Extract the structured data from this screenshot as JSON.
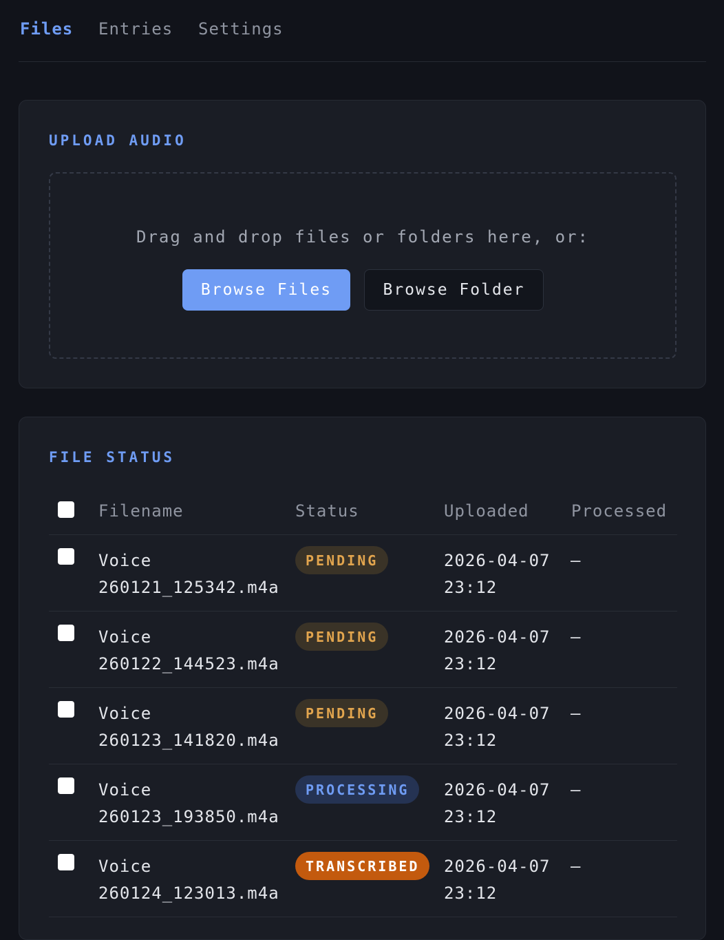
{
  "nav": {
    "tabs": [
      {
        "label": "Files"
      },
      {
        "label": "Entries"
      },
      {
        "label": "Settings"
      }
    ]
  },
  "upload": {
    "title": "UPLOAD AUDIO",
    "drop_text": "Drag and drop files or folders here, or:",
    "browse_files": "Browse Files",
    "browse_folder": "Browse Folder"
  },
  "status": {
    "title": "FILE STATUS",
    "columns": [
      "Filename",
      "Status",
      "Uploaded",
      "Processed"
    ],
    "rows": [
      {
        "filename": "Voice 260121_125342.m4a",
        "status": "PENDING",
        "uploaded": "2026-04-07 23:12",
        "processed": "—"
      },
      {
        "filename": "Voice 260122_144523.m4a",
        "status": "PENDING",
        "uploaded": "2026-04-07 23:12",
        "processed": "—"
      },
      {
        "filename": "Voice 260123_141820.m4a",
        "status": "PENDING",
        "uploaded": "2026-04-07 23:12",
        "processed": "—"
      },
      {
        "filename": "Voice 260123_193850.m4a",
        "status": "PROCESSING",
        "uploaded": "2026-04-07 23:12",
        "processed": "—"
      },
      {
        "filename": "Voice 260124_123013.m4a",
        "status": "TRANSCRIBED",
        "uploaded": "2026-04-07 23:12",
        "processed": "—"
      }
    ]
  },
  "colors": {
    "accent": "#6f9cf4",
    "pending": "#e2a54e",
    "processing": "#6f9cf4",
    "transcribed": "#c35a0e",
    "background": "#11131a"
  }
}
